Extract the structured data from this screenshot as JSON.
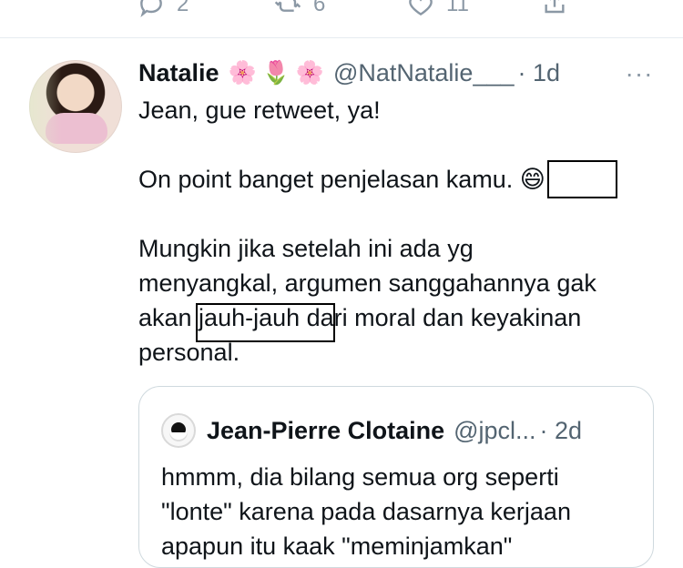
{
  "top_actions": {
    "reply_count": "2",
    "retweet_count": "6",
    "like_count": "11"
  },
  "tweet": {
    "author_name": "Natalie",
    "emoji_1": "🌸",
    "emoji_2": "🌷",
    "emoji_3": "🌸",
    "handle": "@NatNatalie___",
    "time": "· 1d",
    "more_label": "···",
    "lines": {
      "line1": "Jean, gue retweet, ya!",
      "line3": "On point banget penjelasan kamu. 😄",
      "line5": "Mungkin jika setelah ini ada yg",
      "line6": "menyangkal, argumen sanggahannya gak",
      "line7": "akan jauh-jauh dari moral dan keyakinan",
      "line8": "personal."
    }
  },
  "quote": {
    "author_name": "Jean-Pierre Clotaine",
    "handle": "@jpcl...",
    "time": "· 2d",
    "line1": "hmmm, dia bilang semua org seperti",
    "line2": "\"lonte\" karena pada dasarnya kerjaan",
    "line3": "apapun itu kaak \"meminjamkan\""
  },
  "colors": {
    "text": "#0f1419",
    "muted": "#536471",
    "icon": "#8b98a5",
    "border": "#cfd9de"
  },
  "icons": {
    "reply": "reply-icon",
    "retweet": "retweet-icon",
    "like": "heart-icon",
    "share": "share-icon",
    "more": "more-icon"
  }
}
